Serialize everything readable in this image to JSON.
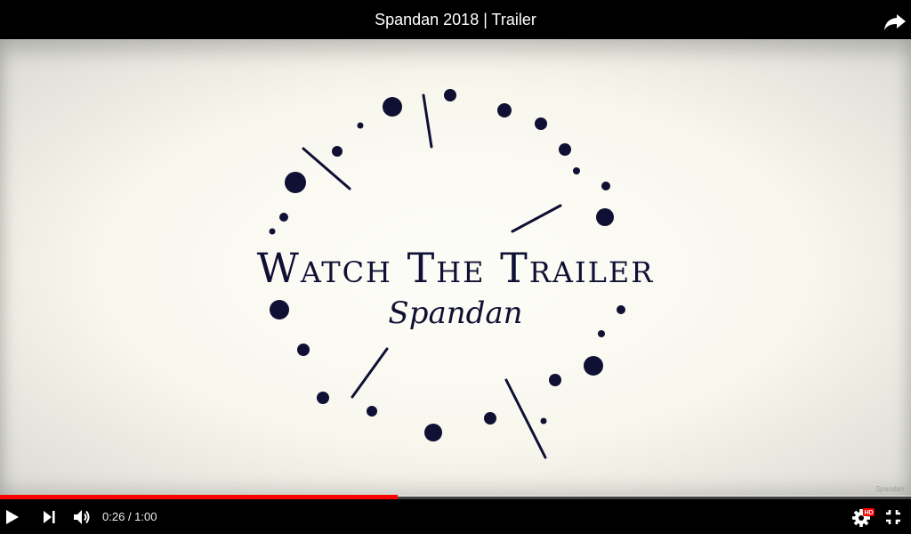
{
  "player": {
    "title": "Spandan 2018 | Trailer",
    "current_time": "0:26",
    "duration": "1:00",
    "progress_fraction": 0.437,
    "quality_badge": "HD",
    "accent_color": "#ff0000",
    "controls": {
      "play": "play-icon",
      "next": "next-icon",
      "volume": "volume-icon",
      "settings": "gear-icon",
      "exit_fullscreen": "exit-fullscreen-icon",
      "share": "share-icon"
    }
  },
  "video_frame": {
    "heading": "Watch The Trailer",
    "subtitle": "Spandan",
    "watermark": "Spandan",
    "ink_color": "#0f1033"
  }
}
